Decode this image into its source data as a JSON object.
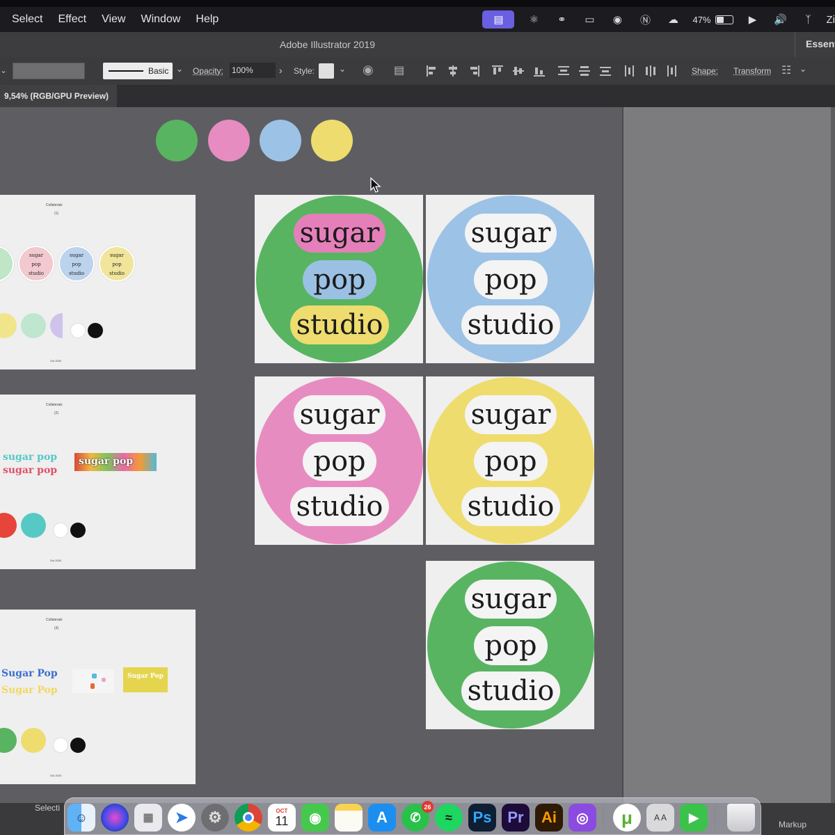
{
  "menubar": {
    "items": [
      "Select",
      "Effect",
      "View",
      "Window",
      "Help"
    ],
    "battery": "47%",
    "cut_right": "Zi"
  },
  "titlebar": {
    "title": "Adobe Illustrator 2019",
    "workspace": "Essent"
  },
  "control": {
    "stroke_profile": "Basic",
    "opacity_label": "Opacity:",
    "opacity_value": "100%",
    "style_label": "Style:",
    "shape_label": "Shape:",
    "transform_label": "Transform"
  },
  "document_tab": "9,54% (RGB/GPU Preview)",
  "palette": [
    "#58b461",
    "#e78cc0",
    "#9cc2e6",
    "#eedc6e"
  ],
  "logo_cards": [
    {
      "bg": "#58b461",
      "pills": [
        "#e57fba",
        "#9ac0e4",
        "#eedc6e"
      ],
      "words": [
        "sugar",
        "pop",
        "studio"
      ]
    },
    {
      "bg": "#9cc2e6",
      "pills": [
        "#f4f4f4",
        "#f4f4f4",
        "#f4f4f4"
      ],
      "words": [
        "sugar",
        "pop",
        "studio"
      ]
    },
    {
      "bg": "#e78cc0",
      "pills": [
        "#f4f4f4",
        "#f4f4f4",
        "#f4f4f4"
      ],
      "words": [
        "sugar",
        "pop",
        "studio"
      ]
    },
    {
      "bg": "#eedc6e",
      "pills": [
        "#f4f4f4",
        "#f4f4f4",
        "#f4f4f4"
      ],
      "words": [
        "sugar",
        "pop",
        "studio"
      ]
    },
    {
      "bg": "#58b461",
      "pills": [
        "#f4f4f4",
        "#f4f4f4",
        "#f4f4f4"
      ],
      "words": [
        "sugar",
        "pop",
        "studio"
      ]
    }
  ],
  "boards": [
    {
      "title": "Collaterals",
      "sub": "(1)",
      "footer": "Oct 2020",
      "mini_logos": [
        {
          "bg": "#f2c9cf",
          "words": [
            "sugar",
            "pop",
            "studio"
          ]
        },
        {
          "bg": "#bcd3ee",
          "words": [
            "sugar",
            "pop",
            "studio"
          ]
        },
        {
          "bg": "#f1e59b",
          "words": [
            "sugar",
            "pop",
            "studio"
          ]
        }
      ]
    },
    {
      "title": "Collaterals",
      "sub": "(2)",
      "footer": "Oct 2020",
      "wordmarks": [
        "sugar pop",
        "sugar pop",
        "sugar pop"
      ]
    },
    {
      "title": "Collaterals",
      "sub": "(3)",
      "footer": "Oct 2020",
      "wordmarks": [
        "Sugar Pop",
        "Sugar Pop",
        "Sugar Pop"
      ]
    }
  ],
  "statusbar": {
    "left": "Selecti",
    "right": "Markup"
  },
  "dock": {
    "calendar_month": "OCT",
    "calendar_day": "11",
    "whatsapp_badge": "26",
    "ps": "Ps",
    "pr": "Pr",
    "ai": "Ai",
    "dictionary": "A A"
  }
}
